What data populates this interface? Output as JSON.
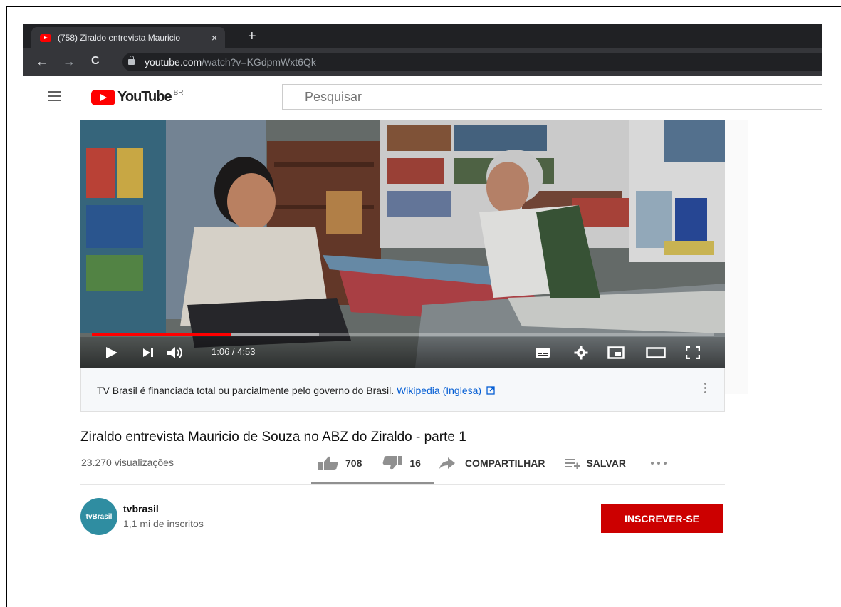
{
  "browser": {
    "tab_title": "(758) Ziraldo entrevista Mauricio",
    "tab_close": "×",
    "new_tab": "+",
    "back": "←",
    "forward": "→",
    "reload": "C",
    "url_host": "youtube.com",
    "url_path": "/watch?v=KGdpmWxt6Qk"
  },
  "youtube": {
    "logo_text": "YouTube",
    "region": "BR",
    "search_placeholder": "Pesquisar"
  },
  "player": {
    "time": "1:06 / 4:53",
    "progress_fraction": 0.225,
    "buffered_fraction": 0.365
  },
  "info_panel": {
    "text": "TV Brasil é financiada total ou parcialmente pelo governo do Brasil.",
    "link": "Wikipedia (Inglesa)"
  },
  "video": {
    "title": "Ziraldo entrevista Mauricio de Souza no ABZ do Ziraldo - parte 1",
    "views": "23.270 visualizações",
    "likes": "708",
    "dislikes": "16",
    "share": "COMPARTILHAR",
    "save": "SALVAR"
  },
  "channel": {
    "avatar_text": "tvBrasil",
    "name": "tvbrasil",
    "subscribers": "1,1 mi de inscritos",
    "subscribe_label": "INSCREVER-SE"
  },
  "colors": {
    "youtube_red": "#ff0000",
    "subscribe_red": "#cc0000",
    "link_blue": "#065fd4",
    "chrome_dark": "#202124"
  }
}
